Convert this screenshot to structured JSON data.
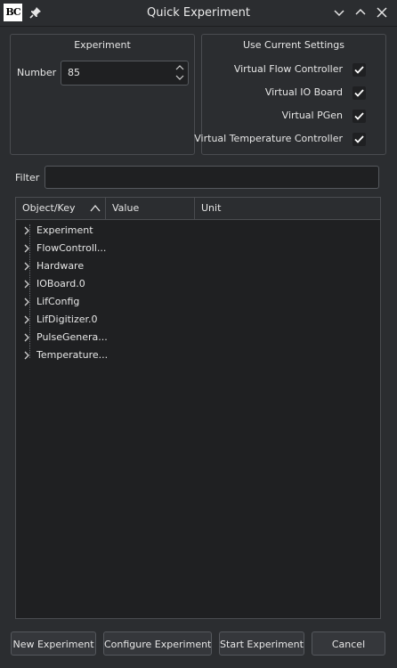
{
  "window": {
    "title": "Quick Experiment",
    "app_icon_text": "BC"
  },
  "experiment_group": {
    "title": "Experiment",
    "number_label": "Number",
    "number_value": "85"
  },
  "settings_group": {
    "title": "Use Current Settings",
    "options": [
      {
        "label": "Virtual Flow Controller",
        "checked": true
      },
      {
        "label": "Virtual IO Board",
        "checked": true
      },
      {
        "label": "Virtual PGen",
        "checked": true
      },
      {
        "label": "Virtual Temperature Controller",
        "checked": true
      }
    ]
  },
  "filter": {
    "label": "Filter",
    "value": ""
  },
  "tree": {
    "columns": [
      "Object/Key",
      "Value",
      "Unit"
    ],
    "sort_column": "Object/Key",
    "sort_direction": "ascending",
    "rows": [
      "Experiment",
      "FlowControll...",
      "Hardware",
      "IOBoard.0",
      "LifConfig",
      "LifDigitizer.0",
      "PulseGenera...",
      "Temperature..."
    ]
  },
  "buttons": {
    "new": "New Experiment",
    "configure": "Configure Experiment",
    "start": "Start Experiment",
    "cancel": "Cancel"
  },
  "colors": {
    "background": "#2b2d30",
    "field": "#1f2022",
    "check_mark": "#ffffff",
    "border": "#4a4c50"
  }
}
